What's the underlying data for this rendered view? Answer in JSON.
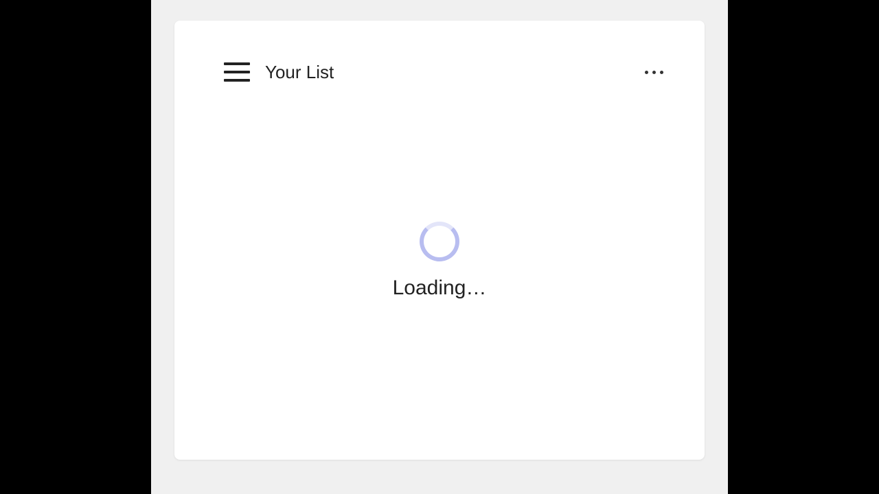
{
  "header": {
    "title": "Your List"
  },
  "body": {
    "loading_text": "Loading…"
  }
}
